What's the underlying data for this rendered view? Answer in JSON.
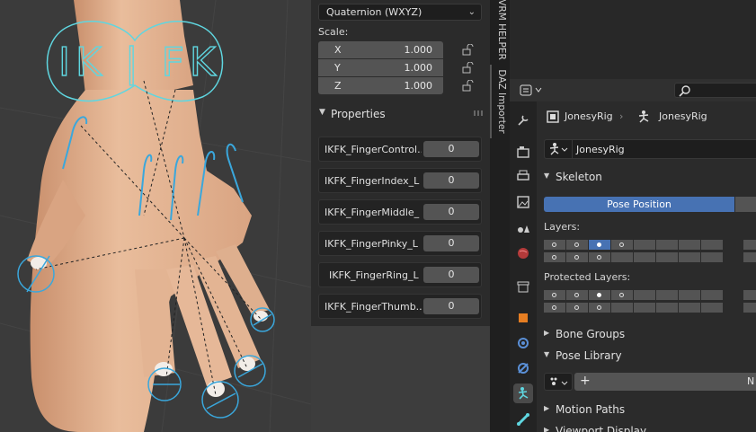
{
  "npanel": {
    "rotation_mode": "Quaternion (WXYZ)",
    "scale_label": "Scale:",
    "scale": [
      {
        "axis": "X",
        "value": "1.000"
      },
      {
        "axis": "Y",
        "value": "1.000"
      },
      {
        "axis": "Z",
        "value": "1.000"
      }
    ],
    "properties_title": "Properties",
    "properties": [
      {
        "name": "IKFK_FingerControl...",
        "value": "0"
      },
      {
        "name": "IKFK_FingerIndex_L",
        "value": "0"
      },
      {
        "name": "IKFK_FingerMiddle_",
        "value": "0"
      },
      {
        "name": "IKFK_FingerPinky_L",
        "value": "0"
      },
      {
        "name": "IKFK_FingerRing_L",
        "value": "0"
      },
      {
        "name": "IKFK_FingerThumb...",
        "value": "0"
      }
    ]
  },
  "viewport": {
    "control_text": "IK | FK"
  },
  "side_tabs": [
    {
      "label": "VRM HELPER"
    },
    {
      "label": "DAZ Importer"
    }
  ],
  "properties_editor": {
    "breadcrumb_object": "JonesyRig",
    "breadcrumb_sep": "›",
    "breadcrumb_data": "JonesyRig",
    "datablock_name": "JonesyRig",
    "sections": {
      "skeleton": "Skeleton",
      "bone_groups": "Bone Groups",
      "pose_library": "Pose Library",
      "motion_paths": "Motion Paths",
      "viewport_display": "Viewport Display"
    },
    "pose_position": "Pose Position",
    "layers_label": "Layers:",
    "protected_layers_label": "Protected Layers:",
    "layers_row1": [
      "o",
      "o",
      "on",
      "o",
      "",
      "",
      "",
      ""
    ],
    "layers_row2": [
      "o",
      "o",
      "o",
      "",
      "",
      "",
      "",
      ""
    ],
    "protected_row1": [
      "o",
      "o",
      "fill",
      "o",
      "",
      "",
      "",
      ""
    ],
    "protected_row2": [
      "o",
      "o",
      "o",
      "",
      "",
      "",
      "",
      ""
    ],
    "pose_library_add": "+",
    "pose_library_n": "N"
  },
  "colors": {
    "accent": "#4772b3",
    "ik_fk_control": "#5fd6e0",
    "skin": "#e3b493"
  }
}
